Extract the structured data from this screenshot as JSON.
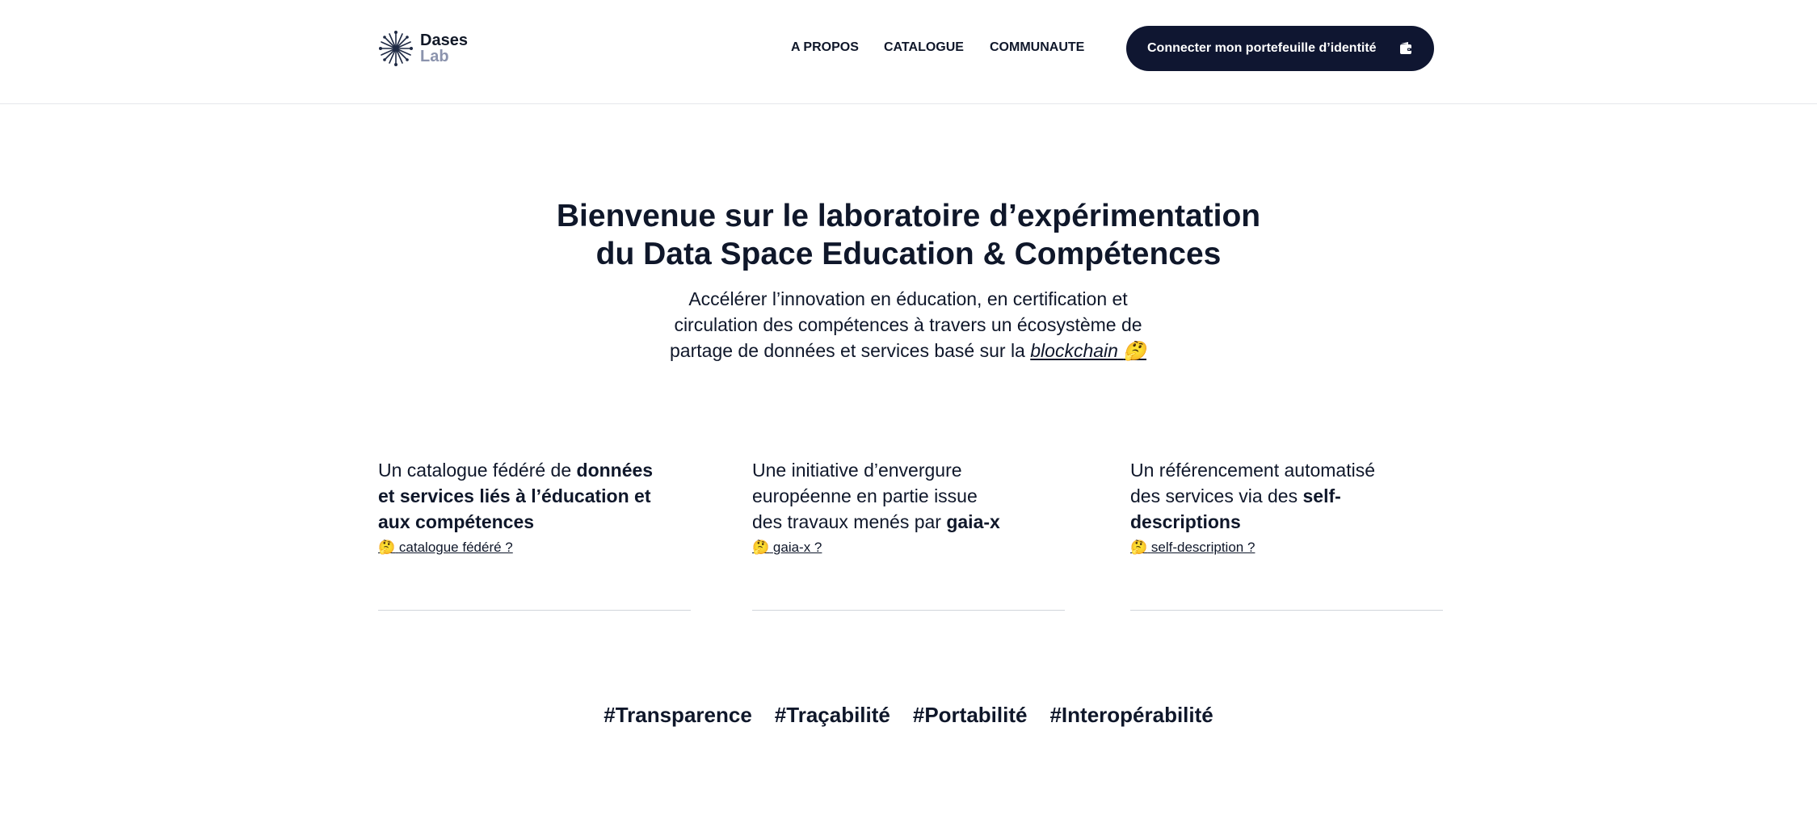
{
  "header": {
    "logo_line1": "Dases",
    "logo_line2": "Lab",
    "nav": [
      "A PROPOS",
      "CATALOGUE",
      "COMMUNAUTE"
    ],
    "connect_label": "Connecter mon portefeuille d’identité"
  },
  "hero": {
    "title_line1": "Bienvenue sur le laboratoire d’expérimentation",
    "title_line2": "du Data Space Education & Compétences",
    "subtitle_line1": "Accélérer l’innovation en éducation, en certification et",
    "subtitle_line2": "circulation des compétences à travers un écosystème de",
    "subtitle_line3_pre": "partage de données et services basé sur la ",
    "subtitle_link": "blockchain",
    "emoji": "🤔"
  },
  "features": [
    {
      "plain1": "Un catalogue fédéré de ",
      "bold1": "données",
      "bold2": "et services liés à l’éducation et",
      "bold3": "aux compétences",
      "link": "catalogue fédéré ?"
    },
    {
      "line1": "Une initiative d’envergure",
      "line2": "européenne en partie issue",
      "line3_pre": "des travaux menés par ",
      "bold": "gaia-x",
      "link": "gaia-x ?"
    },
    {
      "line1": "Un référencement automatisé",
      "line2_pre": "des services via des ",
      "bold1": "self-",
      "bold2": "descriptions",
      "link": "self-description ?"
    }
  ],
  "tags": [
    "#Transparence",
    "#Traçabilité",
    "#Portabilité",
    "#Interopérabilité"
  ],
  "colors": {
    "primary": "#0f1631",
    "text": "#0f172a",
    "logo_muted": "#8b93ad",
    "divider": "#d1d5db"
  }
}
